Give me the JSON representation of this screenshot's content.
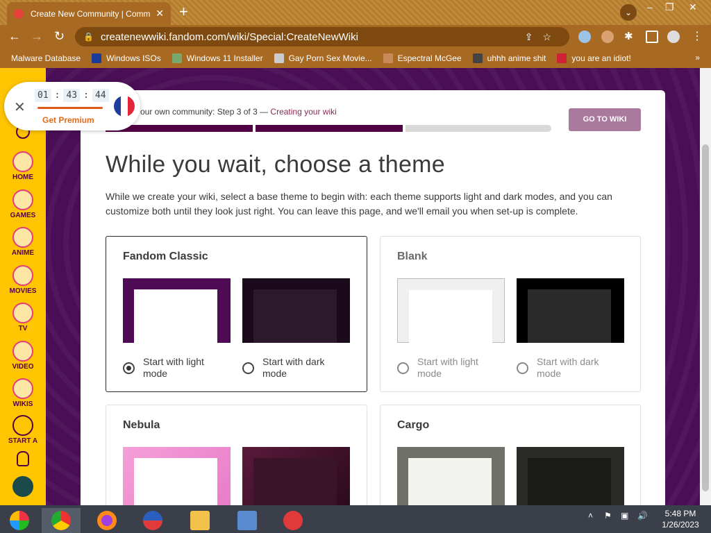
{
  "browser": {
    "tab_title": "Create New Community | Commu...",
    "url": "createnewwiki.fandom.com/wiki/Special:CreateNewWiki",
    "bookmarks": [
      {
        "label": "Malware Database",
        "icon": "folder-icon"
      },
      {
        "label": "Windows ISOs",
        "icon": "x-logo-icon"
      },
      {
        "label": "Windows 11 Installer",
        "icon": "image-icon"
      },
      {
        "label": "Gay Porn Sex Movie...",
        "icon": "box-icon"
      },
      {
        "label": "Espectral McGee",
        "icon": "avatar-icon"
      },
      {
        "label": "uhhh anime shit",
        "icon": "anime-icon"
      },
      {
        "label": "you are an idiot!",
        "icon": "flag-icon"
      }
    ],
    "bookmarks_more": "»"
  },
  "timer": {
    "hours": "01",
    "minutes": "43",
    "seconds": "44",
    "premium_label": "Get Premium"
  },
  "rail": [
    {
      "label": "HOME",
      "icon": "home-icon"
    },
    {
      "label": "GAMES",
      "icon": "gamepad-icon"
    },
    {
      "label": "ANIME",
      "icon": "anime-face-icon"
    },
    {
      "label": "MOVIES",
      "icon": "clapper-icon"
    },
    {
      "label": "TV",
      "icon": "tv-icon"
    },
    {
      "label": "VIDEO",
      "icon": "play-icon"
    },
    {
      "label": "WIKIS",
      "icon": "book-icon"
    },
    {
      "label": "START A",
      "icon": "plus-icon"
    }
  ],
  "wizard": {
    "step_prefix": "our own community: Step 3 of 3 — ",
    "step_link": "Creating your wiki",
    "go_button": "GO TO WIKI",
    "progress_steps_done": 2,
    "progress_steps_total": 3
  },
  "main": {
    "heading": "While you wait, choose a theme",
    "description": "While we create your wiki, select a base theme to begin with: each theme supports light and dark modes, and you can customize both until they look just right. You can leave this page, and we'll email you when set-up is complete."
  },
  "themes": [
    {
      "name": "Fandom Classic",
      "light_label": "Start with light mode",
      "dark_label": "Start with dark mode",
      "selected": "light"
    },
    {
      "name": "Blank",
      "light_label": "Start with light mode",
      "dark_label": "Start with dark mode",
      "selected": "none"
    },
    {
      "name": "Nebula"
    },
    {
      "name": "Cargo"
    }
  ],
  "taskbar": {
    "time": "5:48 PM",
    "date": "1/26/2023"
  },
  "colors": {
    "fandom_yellow": "#ffc500",
    "page_purple": "#4a0e56",
    "chrome_brown": "#a86a22",
    "go_button": "#a9799e"
  }
}
